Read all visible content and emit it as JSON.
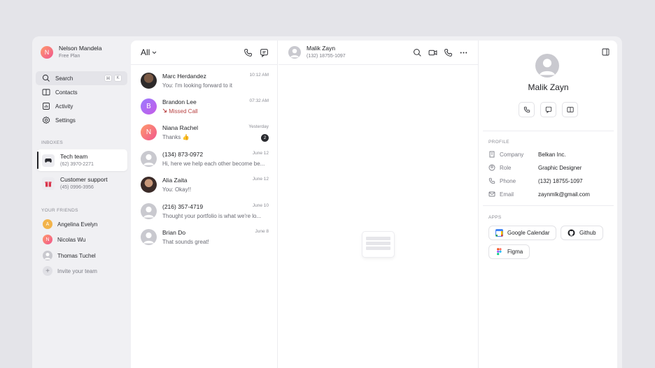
{
  "user": {
    "name": "Nelson Mandela",
    "plan": "Free Plan",
    "initial": "N"
  },
  "nav": {
    "search": "Search",
    "search_shortcut": [
      "⌘",
      "K"
    ],
    "contacts": "Contacts",
    "activity": "Activity",
    "settings": "Settings"
  },
  "inboxes": {
    "label": "INBOXES",
    "items": [
      {
        "name": "Tech team",
        "phone": "(62) 3970-2271"
      },
      {
        "name": "Customer support",
        "phone": "(45) 0996-3956"
      }
    ]
  },
  "friends": {
    "label": "YOUR FRIENDS",
    "items": [
      {
        "name": "Angelina Evelyn",
        "initial": "A"
      },
      {
        "name": "Nicolas Wu",
        "initial": "N"
      },
      {
        "name": "Thomas Tuchel",
        "initial": ""
      }
    ],
    "invite": "Invite your team"
  },
  "list": {
    "filter": "All",
    "conversations": [
      {
        "name": "Marc Herdandez",
        "message": "You: I'm looking forward to it",
        "time": "10:12 AM"
      },
      {
        "name": "Brandon Lee",
        "message": "Missed Call",
        "time": "07:32 AM",
        "initial": "B"
      },
      {
        "name": "Niana Rachel",
        "message": "Thanks 👍",
        "time": "Yesterday",
        "initial": "N",
        "badge": "2"
      },
      {
        "name": "(134) 873-0972",
        "message": "Hi, here we help each other become be...",
        "time": "June 12"
      },
      {
        "name": "Alia Zaita",
        "message": "You: Okay!!",
        "time": "June 12"
      },
      {
        "name": "(216) 357-4719",
        "message": "Thought your portfolio is what we're lo...",
        "time": "June 10"
      },
      {
        "name": "Brian Do",
        "message": "That sounds great!",
        "time": "June 8"
      }
    ]
  },
  "chat": {
    "name": "Malik Zayn",
    "phone": "(132) 18755-1097"
  },
  "profile": {
    "name": "Malik Zayn",
    "section_label": "PROFILE",
    "fields": [
      {
        "label": "Company",
        "value": "Belkan Inc."
      },
      {
        "label": "Role",
        "value": "Graphic Designer"
      },
      {
        "label": "Phone",
        "value": "(132) 18755-1097"
      },
      {
        "label": "Email",
        "value": "zaynmlk@gmail.com"
      }
    ],
    "apps_label": "APPS",
    "apps": [
      "Google Calendar",
      "Github",
      "Figma"
    ]
  },
  "colors": {
    "background": "#e4e4e9",
    "sidebar": "#f0f0f3",
    "card": "#ffffff",
    "missed": "#b84242"
  }
}
